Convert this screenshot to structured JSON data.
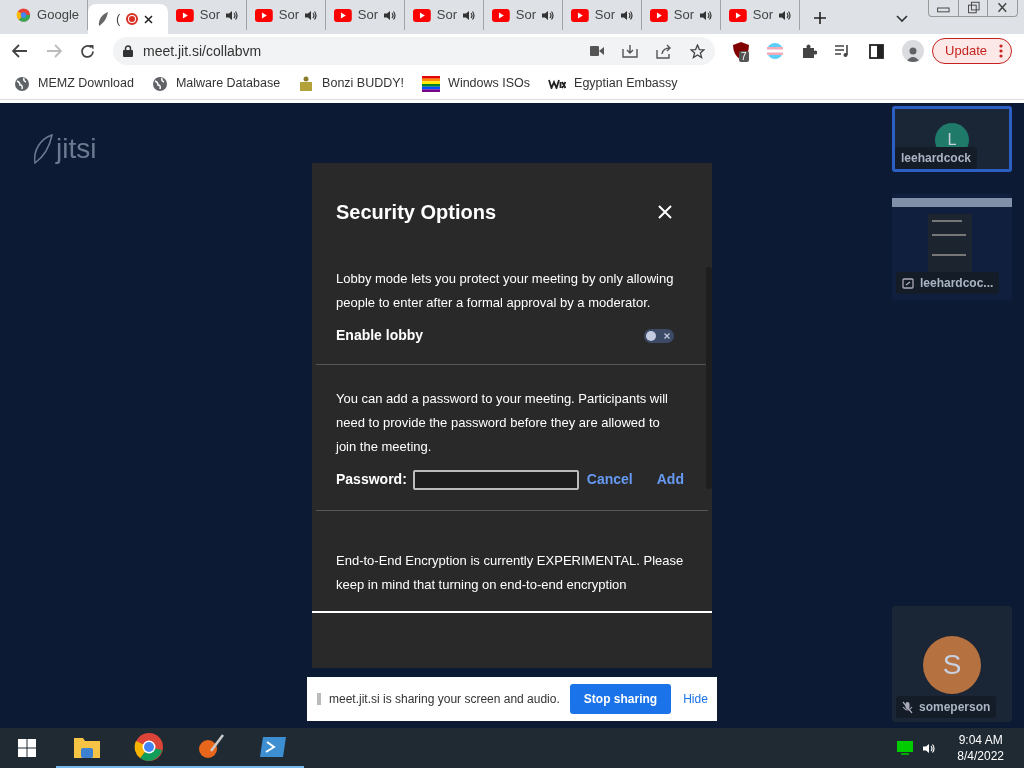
{
  "browser": {
    "tabs": [
      {
        "title": "Google",
        "kind": "google",
        "selected": false,
        "recording": false,
        "audio": false
      },
      {
        "title": "(",
        "kind": "jitsi",
        "selected": true,
        "recording": true,
        "audio": false
      },
      {
        "title": "Sor",
        "kind": "youtube",
        "selected": false,
        "recording": false,
        "audio": true
      },
      {
        "title": "Sor",
        "kind": "youtube",
        "selected": false,
        "recording": false,
        "audio": true
      },
      {
        "title": "Sor",
        "kind": "youtube",
        "selected": false,
        "recording": false,
        "audio": true
      },
      {
        "title": "Sor",
        "kind": "youtube",
        "selected": false,
        "recording": false,
        "audio": true
      },
      {
        "title": "Sor",
        "kind": "youtube",
        "selected": false,
        "recording": false,
        "audio": true
      },
      {
        "title": "Sor",
        "kind": "youtube",
        "selected": false,
        "recording": false,
        "audio": true
      },
      {
        "title": "Sor",
        "kind": "youtube",
        "selected": false,
        "recording": false,
        "audio": true
      },
      {
        "title": "Sor",
        "kind": "youtube",
        "selected": false,
        "recording": false,
        "audio": true
      }
    ],
    "url": "meet.jit.si/collabvm",
    "extension_badge": "7",
    "update_button": "Update",
    "bookmarks": [
      {
        "label": "MEMZ Download",
        "kind": "globe"
      },
      {
        "label": "Malware Database",
        "kind": "globe"
      },
      {
        "label": "Bonzi BUDDY!",
        "kind": "people"
      },
      {
        "label": "Windows ISOs",
        "kind": "rainbow"
      },
      {
        "label": "Egyptian Embassy",
        "kind": "wix"
      }
    ]
  },
  "page": {
    "logo": "jitsi",
    "dialog": {
      "title": "Security Options",
      "lobby_text": "Lobby mode lets you protect your meeting by only allowing people to enter after a formal approval by a moderator.",
      "lobby_label": "Enable lobby",
      "lobby_on": false,
      "password_text": "You can add a password to your meeting. Participants will need to provide the password before they are allowed to join the meeting.",
      "password_label": "Password:",
      "cancel": "Cancel",
      "add": "Add",
      "e2e_text": "End-to-End Encryption is currently EXPERIMENTAL. Please keep in mind that turning on end-to-end encryption"
    },
    "participants": [
      {
        "name": "leehardcock",
        "kind": "avatar",
        "initial": "L",
        "color": "#1f7a6a",
        "selected": true,
        "muted": false
      },
      {
        "name": "leehardcoc...",
        "kind": "screen",
        "selected": false,
        "muted": false
      },
      {
        "name": "someperson",
        "kind": "avatar",
        "initial": "S",
        "color": "#b5713f",
        "selected": false,
        "muted": true
      }
    ],
    "share_bar": {
      "text": "meet.jit.si is sharing your screen and audio.",
      "stop": "Stop sharing",
      "hide": "Hide"
    }
  },
  "taskbar": {
    "apps": [
      {
        "kind": "explorer",
        "running": true
      },
      {
        "kind": "chrome",
        "running": true
      },
      {
        "kind": "paint",
        "running": true
      },
      {
        "kind": "powershell",
        "running": true
      }
    ],
    "time": "9:04 AM",
    "date": "8/4/2022"
  }
}
